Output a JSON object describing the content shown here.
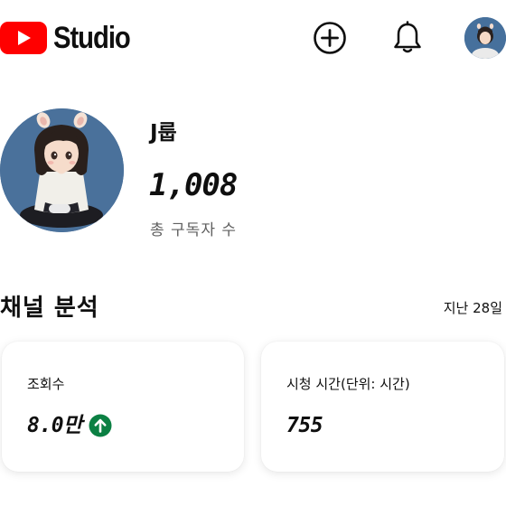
{
  "header": {
    "logo_text": "Studio",
    "brand_color": "#ff0000",
    "icons": [
      "youtube-logo-icon",
      "create-plus-icon",
      "bell-icon",
      "account-avatar"
    ]
  },
  "channel": {
    "name": "J룹",
    "subscriber_count": "1,008",
    "subscriber_label": "총 구독자 수"
  },
  "analytics": {
    "title": "채널 분석",
    "period": "지난 28일",
    "cards": [
      {
        "label": "조회수",
        "value": "8.0만",
        "trend": "up",
        "trend_color": "#0b8043"
      },
      {
        "label": "시청 시간(단위: 시간)",
        "value": "755"
      }
    ]
  }
}
